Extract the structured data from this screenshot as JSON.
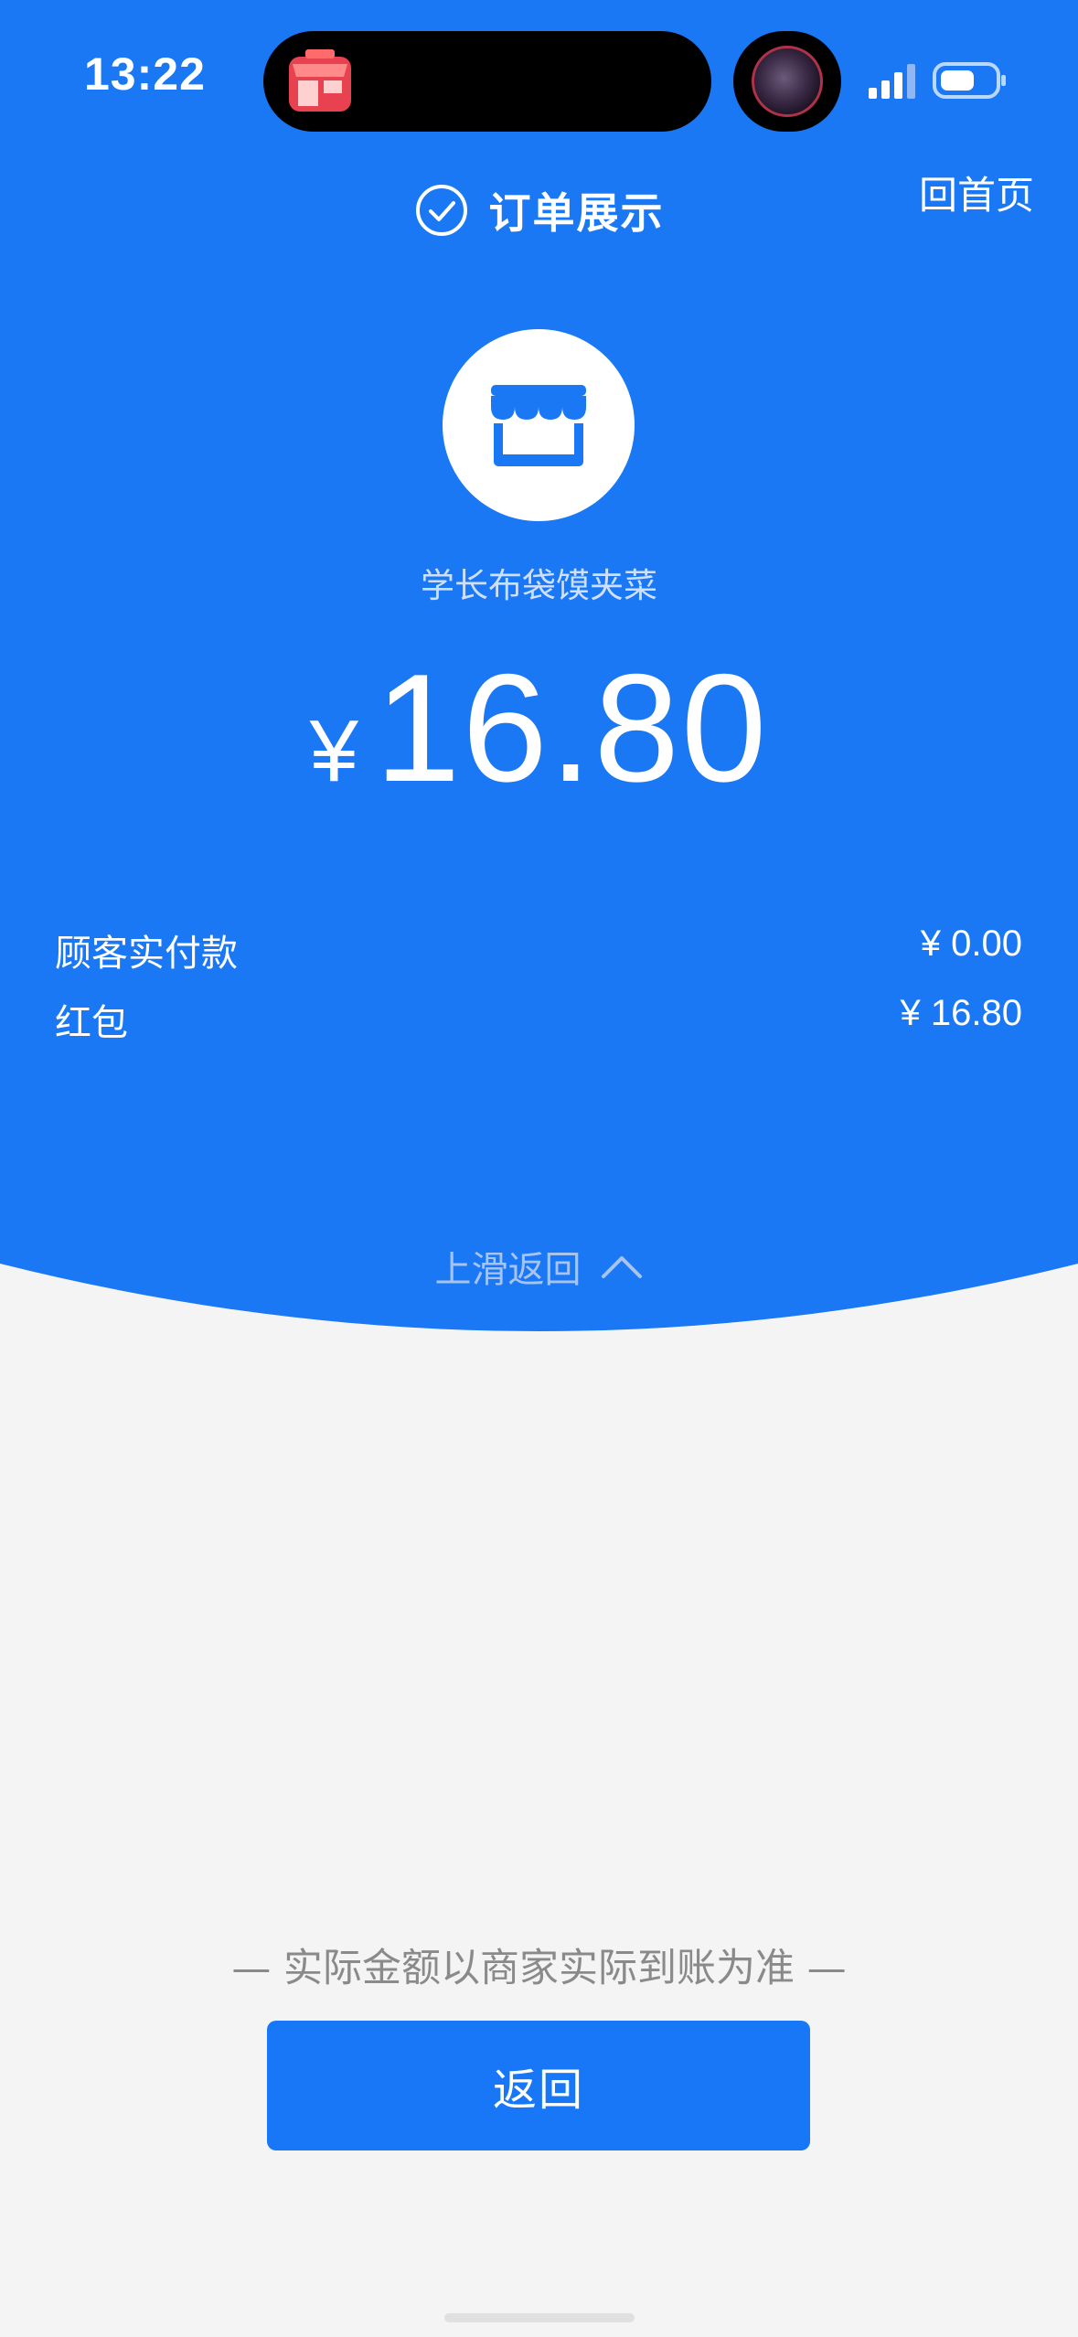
{
  "status_bar": {
    "time": "13:22"
  },
  "header": {
    "title": "订单展示",
    "home_link": "回首页"
  },
  "shop": {
    "name": "学长布袋馍夹菜"
  },
  "amount": {
    "currency": "¥",
    "value": "16.80"
  },
  "details": [
    {
      "label": "顾客实付款",
      "value": "¥ 0.00"
    },
    {
      "label": "红包",
      "value": "¥ 16.80"
    }
  ],
  "swipe_hint": "上滑返回",
  "footnote": "— 实际金额以商家实际到账为准 —",
  "buttons": {
    "return_label": "返回"
  },
  "colors": {
    "primary_blue": "#1a78f5",
    "background": "#f4f4f4",
    "button_blue": "#1877f7"
  },
  "icons": {
    "store_app": "store-icon",
    "check": "check-circle-icon",
    "shop": "storefront-icon",
    "chevron": "chevron-up-icon",
    "signal": "signal-icon",
    "battery": "battery-icon"
  }
}
